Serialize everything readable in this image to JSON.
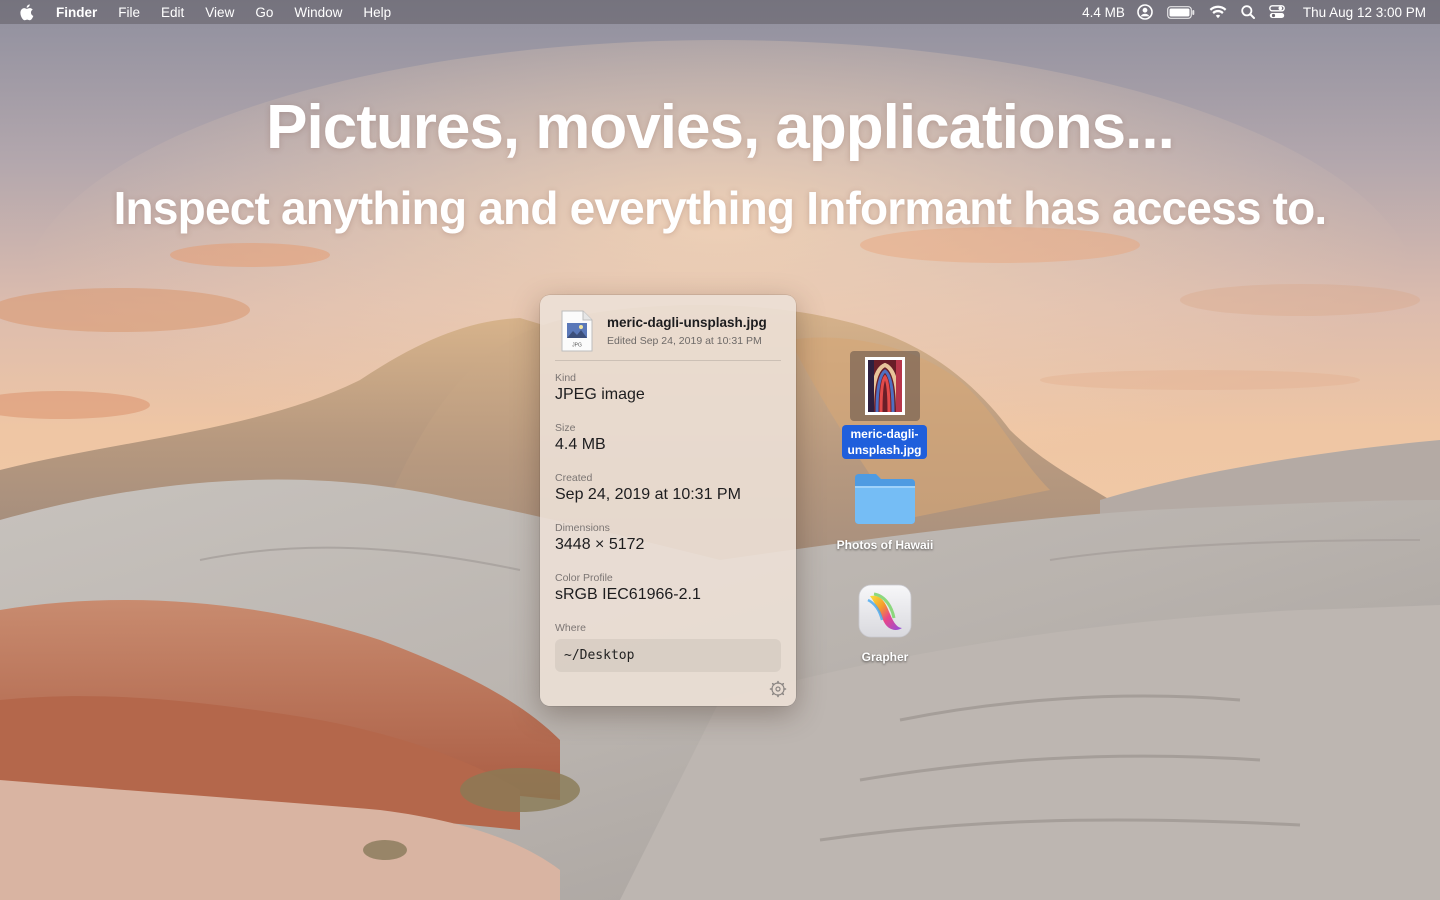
{
  "menubar": {
    "app_name": "Finder",
    "menus": [
      "File",
      "Edit",
      "View",
      "Go",
      "Window",
      "Help"
    ],
    "status_text": "4.4 MB",
    "clock": "Thu Aug 12  3:00 PM",
    "icons": [
      "apple-logo-icon",
      "user-circle-icon",
      "battery-icon",
      "wifi-icon",
      "search-icon",
      "control-center-icon"
    ]
  },
  "hero": {
    "title": "Pictures, movies, applications...",
    "subtitle": "Inspect anything and everything Informant has access to."
  },
  "panel": {
    "file_name": "meric-dagli-unsplash.jpg",
    "edited": "Edited Sep 24, 2019 at 10:31 PM",
    "file_icon_badge": "JPG",
    "fields": [
      {
        "label": "Kind",
        "value": "JPEG image"
      },
      {
        "label": "Size",
        "value": "4.4 MB"
      },
      {
        "label": "Created",
        "value": "Sep 24, 2019 at 10:31 PM"
      },
      {
        "label": "Dimensions",
        "value": "3448 × 5172"
      },
      {
        "label": "Color Profile",
        "value": "sRGB IEC61966-2.1"
      }
    ],
    "where_label": "Where",
    "where_value": "~/Desktop",
    "settings_icon": "gear-icon"
  },
  "desktop": {
    "selected_file_label_line1": "meric-dagli-",
    "selected_file_label_line2": "unsplash.jpg",
    "folder_label": "Photos of Hawaii",
    "app_label": "Grapher"
  },
  "colors": {
    "selection_blue": "#1f5fdc",
    "folder_blue": "#6cb6f2",
    "panel_bg": "#ece0d6"
  }
}
